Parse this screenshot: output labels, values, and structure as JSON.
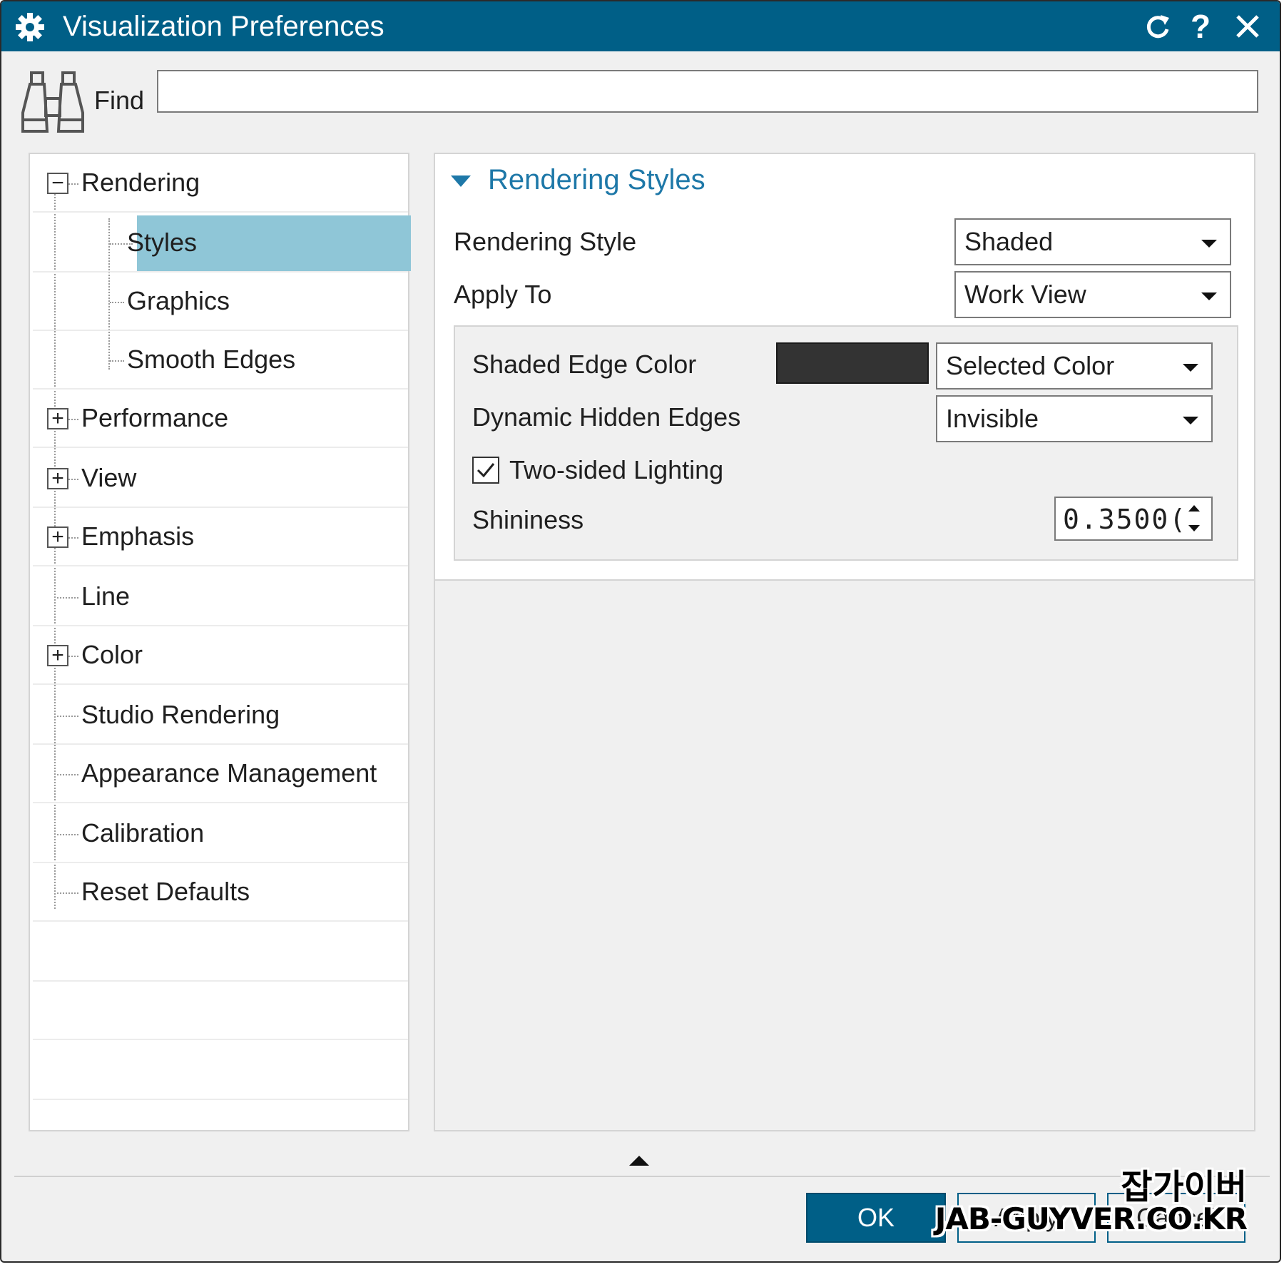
{
  "window": {
    "title": "Visualization Preferences",
    "help_label": "?",
    "colors": {
      "titlebar": "#005f87",
      "accent": "#1e78a8",
      "selection": "#8fc6d7"
    }
  },
  "find": {
    "label": "Find",
    "value": "",
    "placeholder": ""
  },
  "tree": {
    "items": [
      {
        "label": "Rendering",
        "expander": "−"
      },
      {
        "label": "Styles",
        "selected": true
      },
      {
        "label": "Graphics"
      },
      {
        "label": "Smooth Edges"
      },
      {
        "label": "Performance",
        "expander": "+"
      },
      {
        "label": "View",
        "expander": "+"
      },
      {
        "label": "Emphasis",
        "expander": "+"
      },
      {
        "label": "Line"
      },
      {
        "label": "Color",
        "expander": "+"
      },
      {
        "label": "Studio Rendering"
      },
      {
        "label": "Appearance Management"
      },
      {
        "label": "Calibration"
      },
      {
        "label": "Reset Defaults"
      }
    ]
  },
  "panel": {
    "section_title": "Rendering Styles",
    "rendering_style": {
      "label": "Rendering Style",
      "value": "Shaded"
    },
    "apply_to": {
      "label": "Apply To",
      "value": "Work View"
    },
    "shaded_edge_color": {
      "label": "Shaded Edge Color",
      "swatch": "#333333",
      "value": "Selected Color"
    },
    "dynamic_hidden_edges": {
      "label": "Dynamic Hidden Edges",
      "value": "Invisible"
    },
    "two_sided_lighting": {
      "label": "Two-sided Lighting",
      "checked": true
    },
    "shininess": {
      "label": "Shininess",
      "value": "0.3500("
    }
  },
  "footer": {
    "ok_label": "OK",
    "apply_label": "Apply",
    "cancel_label": "Cancel"
  },
  "watermark": {
    "line1": "잡가이버",
    "line2": "JAB-GUYVER.CO.KR"
  }
}
